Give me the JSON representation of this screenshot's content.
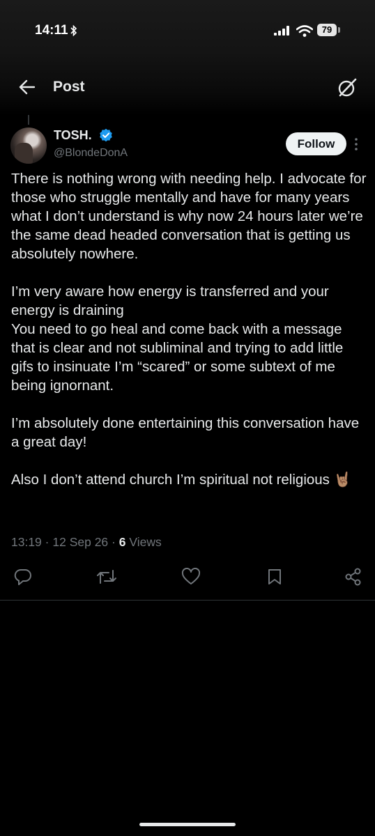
{
  "status_bar": {
    "time": "14:11",
    "battery": "79"
  },
  "header": {
    "title": "Post"
  },
  "tweet": {
    "display_name": "TOSH.",
    "handle": "@BlondeDonA",
    "follow_label": "Follow",
    "text": "There is nothing wrong with needing help.  I advocate for those who struggle mentally and have for many years what I don’t understand is why now 24 hours later we’re the same dead headed conversation that is getting us absolutely nowhere.\n\nI’m very aware how energy is transferred and your energy is draining\n You need to go heal and come back with a message that is clear and not subliminal and trying to add little gifs to insinuate I’m “scared” or some subtext of me being ignornant.\n\nI’m absolutely done entertaining this conversation have a great day!\n\nAlso I don’t attend church I’m spiritual not religious 🤘🏽",
    "time": "13:19",
    "date": "12 Sep 26",
    "views_count": "6",
    "views_label": "Views"
  },
  "icons": {
    "back": "back-arrow-icon",
    "grok": "grok-icon",
    "verified": "verified-badge-icon",
    "reply": "reply-icon",
    "repost": "repost-icon",
    "like": "like-icon",
    "bookmark": "bookmark-icon",
    "share": "share-icon"
  },
  "colors": {
    "background": "#000000",
    "text": "#e7e9ea",
    "muted": "#71767b",
    "verified": "#1d9bf0"
  }
}
